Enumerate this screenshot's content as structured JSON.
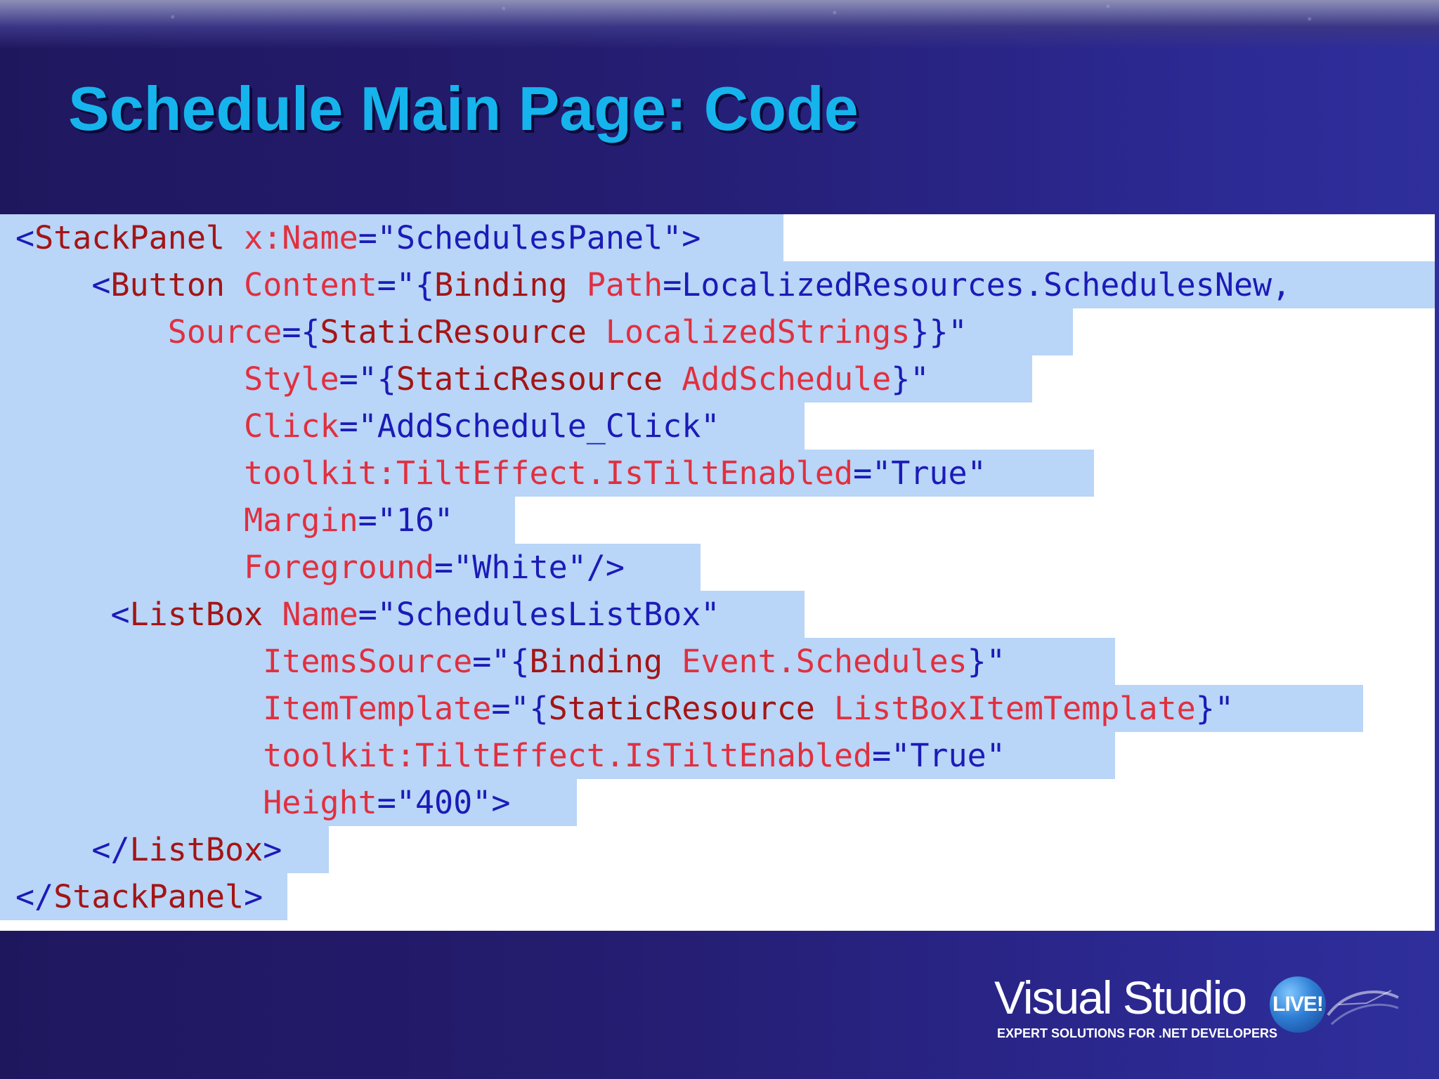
{
  "slide": {
    "title": "Schedule Main Page: Code"
  },
  "code": {
    "lines": [
      [
        {
          "t": "punct",
          "v": "<"
        },
        {
          "t": "tag",
          "v": "StackPanel"
        },
        {
          "t": "sp",
          "v": " "
        },
        {
          "t": "attr",
          "v": "x:Name"
        },
        {
          "t": "punct",
          "v": "=\""
        },
        {
          "t": "val",
          "v": "SchedulesPanel"
        },
        {
          "t": "punct",
          "v": "\">"
        }
      ],
      [
        {
          "t": "sp",
          "v": "    "
        },
        {
          "t": "punct",
          "v": "<"
        },
        {
          "t": "tag",
          "v": "Button"
        },
        {
          "t": "sp",
          "v": " "
        },
        {
          "t": "attr",
          "v": "Content"
        },
        {
          "t": "punct",
          "v": "=\"{"
        },
        {
          "t": "ext",
          "v": "Binding"
        },
        {
          "t": "sp",
          "v": " "
        },
        {
          "t": "attr",
          "v": "Path"
        },
        {
          "t": "punct",
          "v": "="
        },
        {
          "t": "val",
          "v": "LocalizedResources.SchedulesNew,"
        }
      ],
      [
        {
          "t": "sp",
          "v": "        "
        },
        {
          "t": "attr",
          "v": "Source"
        },
        {
          "t": "punct",
          "v": "={"
        },
        {
          "t": "ext",
          "v": "StaticResource"
        },
        {
          "t": "sp",
          "v": " "
        },
        {
          "t": "attr",
          "v": "LocalizedStrings"
        },
        {
          "t": "punct",
          "v": "}}\""
        }
      ],
      [
        {
          "t": "sp",
          "v": "            "
        },
        {
          "t": "attr",
          "v": "Style"
        },
        {
          "t": "punct",
          "v": "=\"{"
        },
        {
          "t": "ext",
          "v": "StaticResource"
        },
        {
          "t": "sp",
          "v": " "
        },
        {
          "t": "attr",
          "v": "AddSchedule"
        },
        {
          "t": "punct",
          "v": "}\""
        }
      ],
      [
        {
          "t": "sp",
          "v": "            "
        },
        {
          "t": "attr",
          "v": "Click"
        },
        {
          "t": "punct",
          "v": "=\""
        },
        {
          "t": "val",
          "v": "AddSchedule_Click"
        },
        {
          "t": "punct",
          "v": "\""
        }
      ],
      [
        {
          "t": "sp",
          "v": "            "
        },
        {
          "t": "attr",
          "v": "toolkit:TiltEffect.IsTiltEnabled"
        },
        {
          "t": "punct",
          "v": "=\""
        },
        {
          "t": "val",
          "v": "True"
        },
        {
          "t": "punct",
          "v": "\""
        }
      ],
      [
        {
          "t": "sp",
          "v": "            "
        },
        {
          "t": "attr",
          "v": "Margin"
        },
        {
          "t": "punct",
          "v": "=\""
        },
        {
          "t": "val",
          "v": "16"
        },
        {
          "t": "punct",
          "v": "\""
        }
      ],
      [
        {
          "t": "sp",
          "v": "            "
        },
        {
          "t": "attr",
          "v": "Foreground"
        },
        {
          "t": "punct",
          "v": "=\""
        },
        {
          "t": "val",
          "v": "White"
        },
        {
          "t": "punct",
          "v": "\"/>"
        }
      ],
      [
        {
          "t": "sp",
          "v": "     "
        },
        {
          "t": "punct",
          "v": "<"
        },
        {
          "t": "tag",
          "v": "ListBox"
        },
        {
          "t": "sp",
          "v": " "
        },
        {
          "t": "attr",
          "v": "Name"
        },
        {
          "t": "punct",
          "v": "=\""
        },
        {
          "t": "val",
          "v": "SchedulesListBox"
        },
        {
          "t": "punct",
          "v": "\""
        }
      ],
      [
        {
          "t": "sp",
          "v": "             "
        },
        {
          "t": "attr",
          "v": "ItemsSource"
        },
        {
          "t": "punct",
          "v": "=\"{"
        },
        {
          "t": "ext",
          "v": "Binding"
        },
        {
          "t": "sp",
          "v": " "
        },
        {
          "t": "attr",
          "v": "Event.Schedules"
        },
        {
          "t": "punct",
          "v": "}\""
        }
      ],
      [
        {
          "t": "sp",
          "v": "             "
        },
        {
          "t": "attr",
          "v": "ItemTemplate"
        },
        {
          "t": "punct",
          "v": "=\"{"
        },
        {
          "t": "ext",
          "v": "StaticResource"
        },
        {
          "t": "sp",
          "v": " "
        },
        {
          "t": "attr",
          "v": "ListBoxItemTemplate"
        },
        {
          "t": "punct",
          "v": "}\""
        }
      ],
      [
        {
          "t": "sp",
          "v": "             "
        },
        {
          "t": "attr",
          "v": "toolkit:TiltEffect.IsTiltEnabled"
        },
        {
          "t": "punct",
          "v": "=\""
        },
        {
          "t": "val",
          "v": "True"
        },
        {
          "t": "punct",
          "v": "\""
        }
      ],
      [
        {
          "t": "sp",
          "v": "             "
        },
        {
          "t": "attr",
          "v": "Height"
        },
        {
          "t": "punct",
          "v": "=\""
        },
        {
          "t": "val",
          "v": "400"
        },
        {
          "t": "punct",
          "v": "\">"
        }
      ],
      [
        {
          "t": "sp",
          "v": "    "
        },
        {
          "t": "punct",
          "v": "</"
        },
        {
          "t": "tag",
          "v": "ListBox"
        },
        {
          "t": "punct",
          "v": ">"
        }
      ],
      [
        {
          "t": "punct",
          "v": "</"
        },
        {
          "t": "tag",
          "v": "StackPanel"
        },
        {
          "t": "punct",
          "v": ">"
        }
      ]
    ]
  },
  "logo": {
    "brand": "Visual Studio",
    "badge": "LIVE!",
    "tagline": "EXPERT SOLUTIONS FOR .NET DEVELOPERS"
  },
  "colors": {
    "title": "#16b4ec",
    "selection": "#b9d5f7",
    "tag": "#a31515",
    "attribute": "#e0303f",
    "value": "#1b1bb7"
  }
}
